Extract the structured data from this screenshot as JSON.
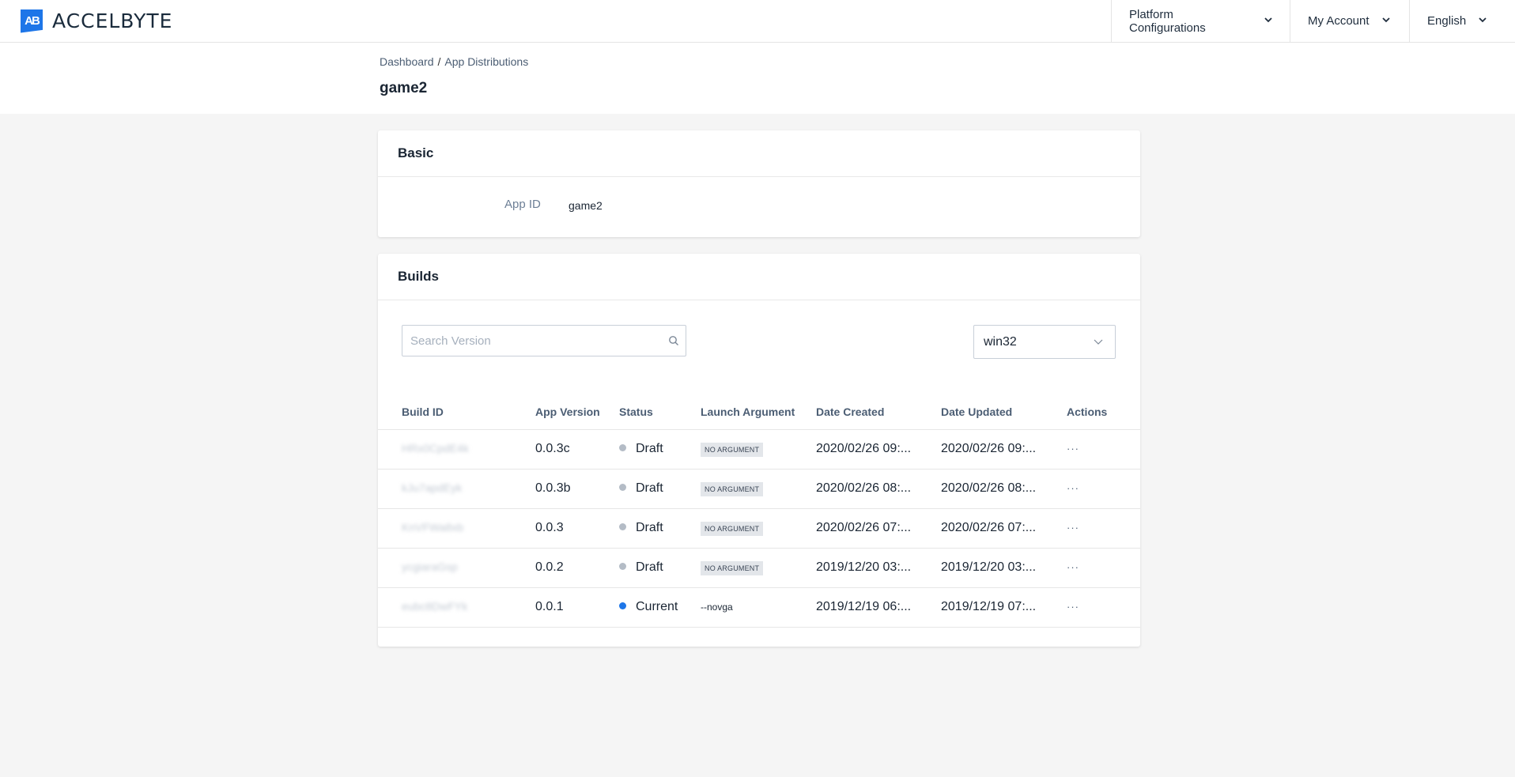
{
  "brand": {
    "logo_mark": "AB",
    "name": "ACCELBYTE",
    "accent": "#1e76e8"
  },
  "nav": {
    "platform": "Platform Configurations",
    "account": "My Account",
    "language": "English"
  },
  "breadcrumb": {
    "home": "Dashboard",
    "sep": "/",
    "current": "App Distributions"
  },
  "page_title": "game2",
  "basic": {
    "title": "Basic",
    "app_id_label": "App ID",
    "app_id_value": "game2"
  },
  "builds": {
    "title": "Builds",
    "search_placeholder": "Search Version",
    "platform_selected": "win32",
    "columns": [
      "Build ID",
      "App Version",
      "Status",
      "Launch Argument",
      "Date Created",
      "Date Updated",
      "Actions"
    ],
    "rows": [
      {
        "id": "HRx0CpdE4k",
        "version": "0.0.3c",
        "status": "Draft",
        "status_color": "#b4bcc6",
        "launch": "NO ARGUMENT",
        "launch_is_tag": true,
        "created": "2020/02/26 09:...",
        "updated": "2020/02/26 09:...",
        "actions": "···"
      },
      {
        "id": "kJu7apdEyk",
        "version": "0.0.3b",
        "status": "Draft",
        "status_color": "#b4bcc6",
        "launch": "NO ARGUMENT",
        "launch_is_tag": true,
        "created": "2020/02/26 08:...",
        "updated": "2020/02/26 08:...",
        "actions": "···"
      },
      {
        "id": "KnVFWa8xb",
        "version": "0.0.3",
        "status": "Draft",
        "status_color": "#b4bcc6",
        "launch": "NO ARGUMENT",
        "launch_is_tag": true,
        "created": "2020/02/26 07:...",
        "updated": "2020/02/26 07:...",
        "actions": "···"
      },
      {
        "id": "ycgiaraGsp",
        "version": "0.0.2",
        "status": "Draft",
        "status_color": "#b4bcc6",
        "launch": "NO ARGUMENT",
        "launch_is_tag": true,
        "created": "2019/12/20 03:...",
        "updated": "2019/12/20 03:...",
        "actions": "···"
      },
      {
        "id": "eubc8DwFYk",
        "version": "0.0.1",
        "status": "Current",
        "status_color": "#1e76e8",
        "launch": "--novga",
        "launch_is_tag": false,
        "created": "2019/12/19 06:...",
        "updated": "2019/12/19 07:...",
        "actions": "···"
      }
    ]
  }
}
